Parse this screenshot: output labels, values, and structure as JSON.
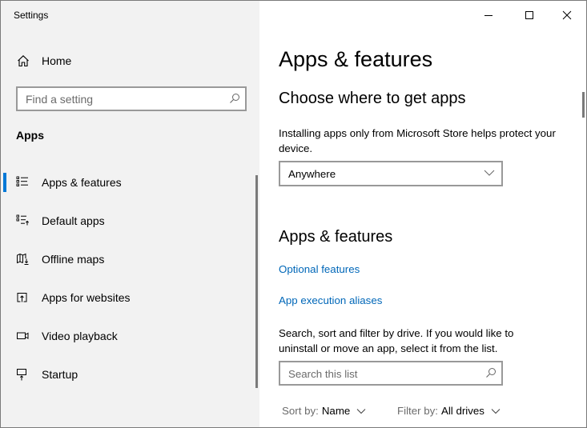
{
  "window": {
    "title": "Settings",
    "controls": {
      "minimize": "minimize",
      "maximize": "maximize",
      "close": "close"
    }
  },
  "sidebar": {
    "home_label": "Home",
    "search_placeholder": "Find a setting",
    "section_label": "Apps",
    "items": [
      {
        "label": "Apps & features",
        "icon": "apps-features-icon",
        "selected": true
      },
      {
        "label": "Default apps",
        "icon": "default-apps-icon",
        "selected": false
      },
      {
        "label": "Offline maps",
        "icon": "offline-maps-icon",
        "selected": false
      },
      {
        "label": "Apps for websites",
        "icon": "apps-for-websites-icon",
        "selected": false
      },
      {
        "label": "Video playback",
        "icon": "video-playback-icon",
        "selected": false
      },
      {
        "label": "Startup",
        "icon": "startup-icon",
        "selected": false
      }
    ]
  },
  "main": {
    "page_title": "Apps & features",
    "choose": {
      "heading": "Choose where to get apps",
      "description": "Installing apps only from Microsoft Store helps protect your device.",
      "dropdown_value": "Anywhere"
    },
    "apps_features": {
      "heading": "Apps & features",
      "links": [
        "Optional features",
        "App execution aliases"
      ],
      "description": "Search, sort and filter by drive. If you would like to uninstall or move an app, select it from the list.",
      "search_placeholder": "Search this list",
      "sort_label": "Sort by:",
      "sort_value": "Name",
      "filter_label": "Filter by:",
      "filter_value": "All drives"
    }
  },
  "colors": {
    "accent": "#0078d7",
    "link": "#0067b8",
    "sidebar_bg": "#f2f2f2"
  }
}
